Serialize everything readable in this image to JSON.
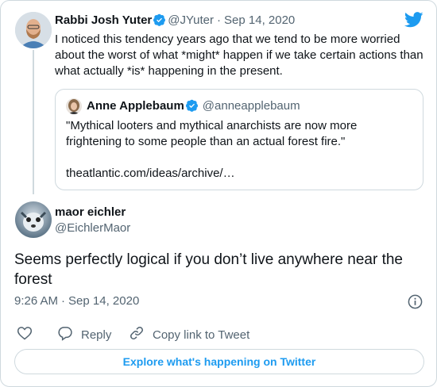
{
  "tweet_parent": {
    "author_name": "Rabbi Josh Yuter",
    "author_handle": "@JYuter",
    "date": "Sep 14, 2020",
    "text_lines": [
      "I noticed this tendency years ago that we tend to be more worried",
      "about the worst of what *might* happen if we take certain actions than",
      "what actually *is* happening in the present."
    ]
  },
  "quoted_tweet": {
    "author_name": "Anne Applebaum",
    "author_handle": "@anneapplebaum",
    "text_lines": [
      "\"Mythical looters and mythical anarchists are now more",
      "frightening to some people than an actual forest fire.\""
    ],
    "link": "theatlantic.com/ideas/archive/…"
  },
  "tweet_main": {
    "author_name": "maor eichler",
    "author_handle": "@EichlerMaor",
    "text_lines": [
      "Seems perfectly logical if you don’t live anywhere near the",
      "forest"
    ],
    "time": "9:26 AM",
    "date": "Sep 14, 2020"
  },
  "actions": {
    "reply_label": "Reply",
    "copy_link_label": "Copy link to Tweet"
  },
  "explore_label": "Explore what's happening on Twitter",
  "colors": {
    "twitter_blue": "#1d9bf0",
    "verified_blue": "#1d9bf0",
    "border": "#cfd9de",
    "muted_text": "#536471"
  },
  "icons": [
    "twitter-bird-icon",
    "verified-badge-icon",
    "info-icon",
    "heart-icon",
    "reply-bubble-icon",
    "link-icon"
  ]
}
